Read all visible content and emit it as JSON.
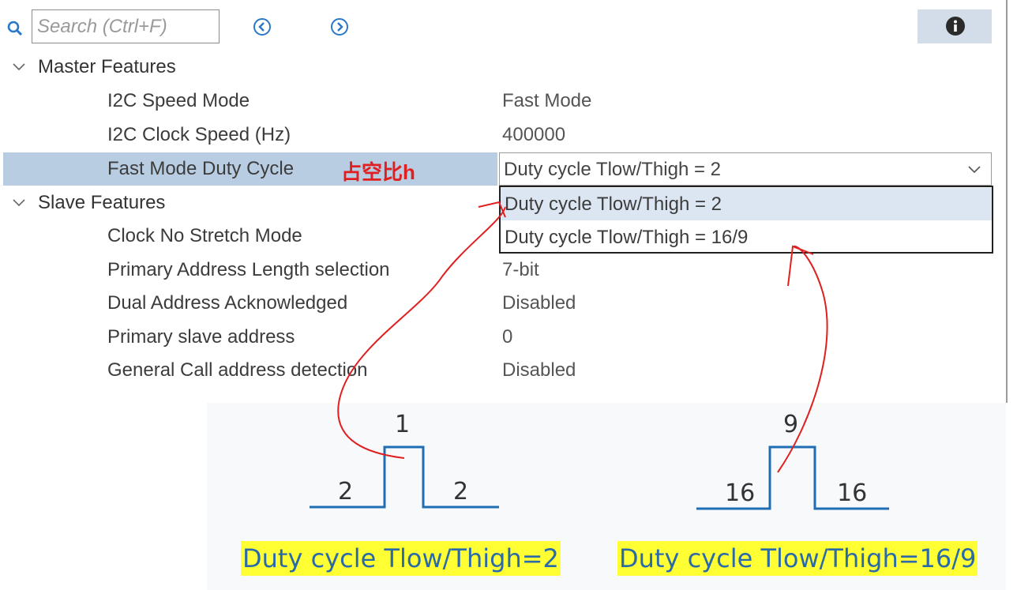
{
  "toolbar": {
    "search_placeholder": "Search (Ctrl+F)",
    "icons": [
      "search-icon",
      "back-icon",
      "forward-icon",
      "info-icon"
    ]
  },
  "groups": {
    "master": {
      "label": "Master Features"
    },
    "slave": {
      "label": "Slave Features"
    }
  },
  "master_rows": [
    {
      "label": "I2C Speed Mode",
      "value": "Fast Mode"
    },
    {
      "label": "I2C Clock Speed (Hz)",
      "value": "400000"
    },
    {
      "label": "Fast Mode Duty Cycle",
      "value": "Duty cycle Tlow/Thigh = 2"
    }
  ],
  "annotation": "占空比h",
  "dropdown_options": [
    "Duty cycle Tlow/Thigh = 2",
    "Duty cycle Tlow/Thigh = 16/9"
  ],
  "slave_rows": [
    {
      "label": "Clock No Stretch Mode",
      "value": ""
    },
    {
      "label": "Primary Address Length selection",
      "value": "7-bit"
    },
    {
      "label": "Dual Address Acknowledged",
      "value": "Disabled"
    },
    {
      "label": "Primary slave address",
      "value": "0"
    },
    {
      "label": "General Call address detection",
      "value": "Disabled"
    }
  ],
  "waveforms": [
    {
      "low_left": "2",
      "high": "1",
      "low_right": "2",
      "caption": "Duty cycle Tlow/Thigh=2"
    },
    {
      "low_left": "16",
      "high": "9",
      "low_right": "16",
      "caption": "Duty cycle Tlow/Thigh=16/9"
    }
  ],
  "colors": {
    "selection": "#b8cde2",
    "hover": "#dbe6f2",
    "annotation_red": "#e02020",
    "waveform_blue": "#1f6db3",
    "caption_highlight": "#ffff33"
  }
}
